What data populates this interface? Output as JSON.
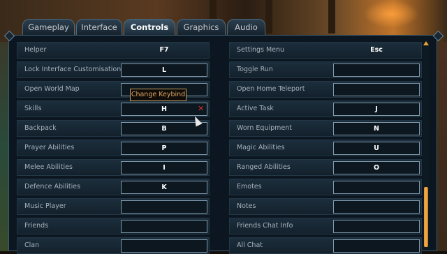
{
  "tabs": [
    {
      "label": "Gameplay",
      "active": false
    },
    {
      "label": "Interface",
      "active": false
    },
    {
      "label": "Controls",
      "active": true
    },
    {
      "label": "Graphics",
      "active": false
    },
    {
      "label": "Audio",
      "active": false
    }
  ],
  "left_rows": [
    {
      "label": "Helper",
      "key": "F7",
      "boxed": false
    },
    {
      "label": "Lock Interface Customisation",
      "key": "L",
      "boxed": true
    },
    {
      "label": "Open World Map",
      "key": "",
      "boxed": true
    },
    {
      "label": "Skills",
      "key": "H",
      "boxed": true,
      "clear": "✕"
    },
    {
      "label": "Backpack",
      "key": "B",
      "boxed": true
    },
    {
      "label": "Prayer Abilities",
      "key": "P",
      "boxed": true
    },
    {
      "label": "Melee Abilities",
      "key": "I",
      "boxed": true
    },
    {
      "label": "Defence Abilities",
      "key": "K",
      "boxed": true
    },
    {
      "label": "Music Player",
      "key": "",
      "boxed": true
    },
    {
      "label": "Friends",
      "key": "",
      "boxed": true
    },
    {
      "label": "Clan",
      "key": "",
      "boxed": true
    }
  ],
  "right_rows": [
    {
      "label": "Settings Menu",
      "key": "Esc",
      "boxed": false
    },
    {
      "label": "Toggle Run",
      "key": "",
      "boxed": true
    },
    {
      "label": "Open Home Teleport",
      "key": "",
      "boxed": true
    },
    {
      "label": "Active Task",
      "key": "J",
      "boxed": true
    },
    {
      "label": "Worn Equipment",
      "key": "N",
      "boxed": true
    },
    {
      "label": "Magic Abilities",
      "key": "U",
      "boxed": true
    },
    {
      "label": "Ranged Abilities",
      "key": "O",
      "boxed": true
    },
    {
      "label": "Emotes",
      "key": "",
      "boxed": true
    },
    {
      "label": "Notes",
      "key": "",
      "boxed": true
    },
    {
      "label": "Friends Chat Info",
      "key": "",
      "boxed": true
    },
    {
      "label": "All Chat",
      "key": "",
      "boxed": true
    }
  ],
  "tooltip": {
    "text": "Change Keybind"
  },
  "colors": {
    "accent": "#e9a23a",
    "text": "#a6b2bc",
    "tooltip_text": "#e0a860",
    "clear": "#d03030"
  },
  "icons": {
    "clear": "close-icon",
    "scroll_up": "arrow-up-icon",
    "cursor": "mouse-pointer-icon"
  }
}
